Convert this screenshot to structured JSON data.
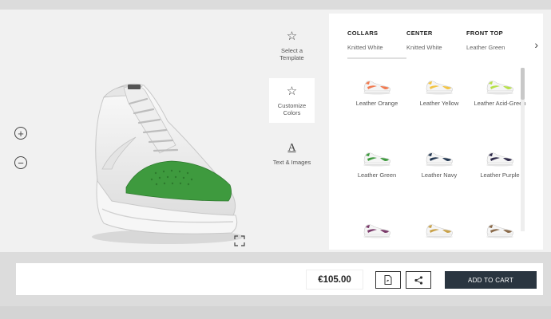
{
  "tools": {
    "template_label": "Select a Template",
    "colors_label": "Customize Colors",
    "text_label": "Text & Images"
  },
  "zoom": {
    "in_symbol": "+",
    "out_symbol": "−"
  },
  "tabs": [
    {
      "title": "COLLARS",
      "value": "Knitted White"
    },
    {
      "title": "CENTER",
      "value": "Knitted White"
    },
    {
      "title": "FRONT TOP",
      "value": "Leather Green"
    }
  ],
  "swatches": [
    {
      "label": "Leather Orange",
      "color": "#f07a50"
    },
    {
      "label": "Leather Yellow",
      "color": "#f2c445"
    },
    {
      "label": "Leather Acid-Green",
      "color": "#b7e04a"
    },
    {
      "label": "Leather Green",
      "color": "#3e9a3e"
    },
    {
      "label": "Leather Navy",
      "color": "#243852"
    },
    {
      "label": "Leather Purple",
      "color": "#2f2a4a"
    },
    {
      "label": "",
      "color": "#7a3a6a"
    },
    {
      "label": "",
      "color": "#c9a24a"
    },
    {
      "label": "",
      "color": "#8a6a4a"
    }
  ],
  "price": "€105.00",
  "cart_label": "ADD TO CART",
  "colors": {
    "dark_button": "#2a3540",
    "toe_green": "#3e9a3e"
  }
}
